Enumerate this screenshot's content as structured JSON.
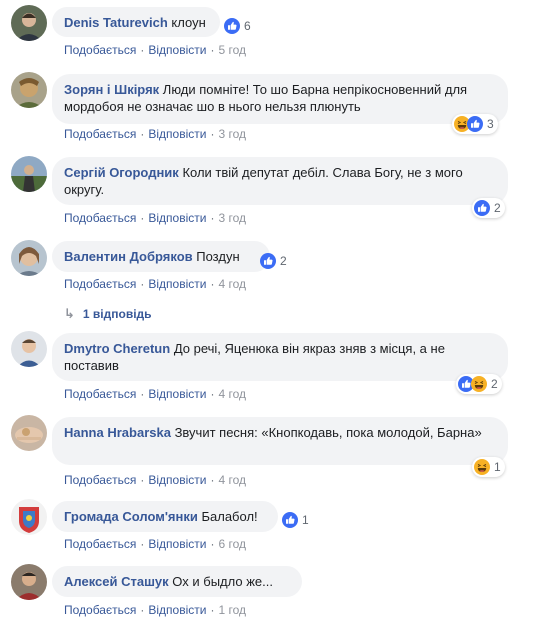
{
  "labels": {
    "like": "Подобається",
    "reply": "Відповісти",
    "sep": "·"
  },
  "comments": [
    {
      "author": "Denis Taturevich",
      "text": "клоун",
      "time": "5 год",
      "reactions": [
        "like-icon"
      ],
      "count": "6"
    },
    {
      "author": "Зорян і Шкіряк",
      "text": "Люди помніте! То шо Барна непрікосновенний для мордобоя не означає шо в нього нельзя плюнуть",
      "time": "3 год",
      "reactions": [
        "haha-icon",
        "like-icon"
      ],
      "count": "3"
    },
    {
      "author": "Сергій Огородник",
      "text": "Коли твій депутат дебіл. Слава Богу, не з мого округу.",
      "time": "3 год",
      "reactions": [
        "like-icon"
      ],
      "count": "2"
    },
    {
      "author": "Валентин Добряков",
      "text": "Поздун",
      "time": "4 год",
      "reactions": [
        "like-icon"
      ],
      "count": "2"
    },
    {
      "author": "Dmytro Cheretun",
      "text": "До речі, Яценюка він якраз зняв з місця, а не поставив",
      "time": "4 год",
      "reactions": [
        "like-icon",
        "haha-icon"
      ],
      "count": "2"
    },
    {
      "author": "Hanna Hrabarska",
      "text": "Звучит песня: «Кнопкодавь, пока молодой, Барна»",
      "time": "4 год",
      "reactions": [
        "haha-icon"
      ],
      "count": "1"
    },
    {
      "author": "Громада Солом'янки",
      "text": "Балабол!",
      "time": "6 год",
      "reactions": [
        "like-icon"
      ],
      "count": "1"
    },
    {
      "author": "Алексей Сташук",
      "text": "Ох и быдло же...",
      "time": "1 год",
      "reactions": [],
      "count": ""
    }
  ],
  "replies_link": "1 відповідь",
  "colors": {
    "link": "#385898",
    "bubble": "#f2f3f5",
    "like": "#3b6cf5",
    "haha": "#f7b125"
  }
}
